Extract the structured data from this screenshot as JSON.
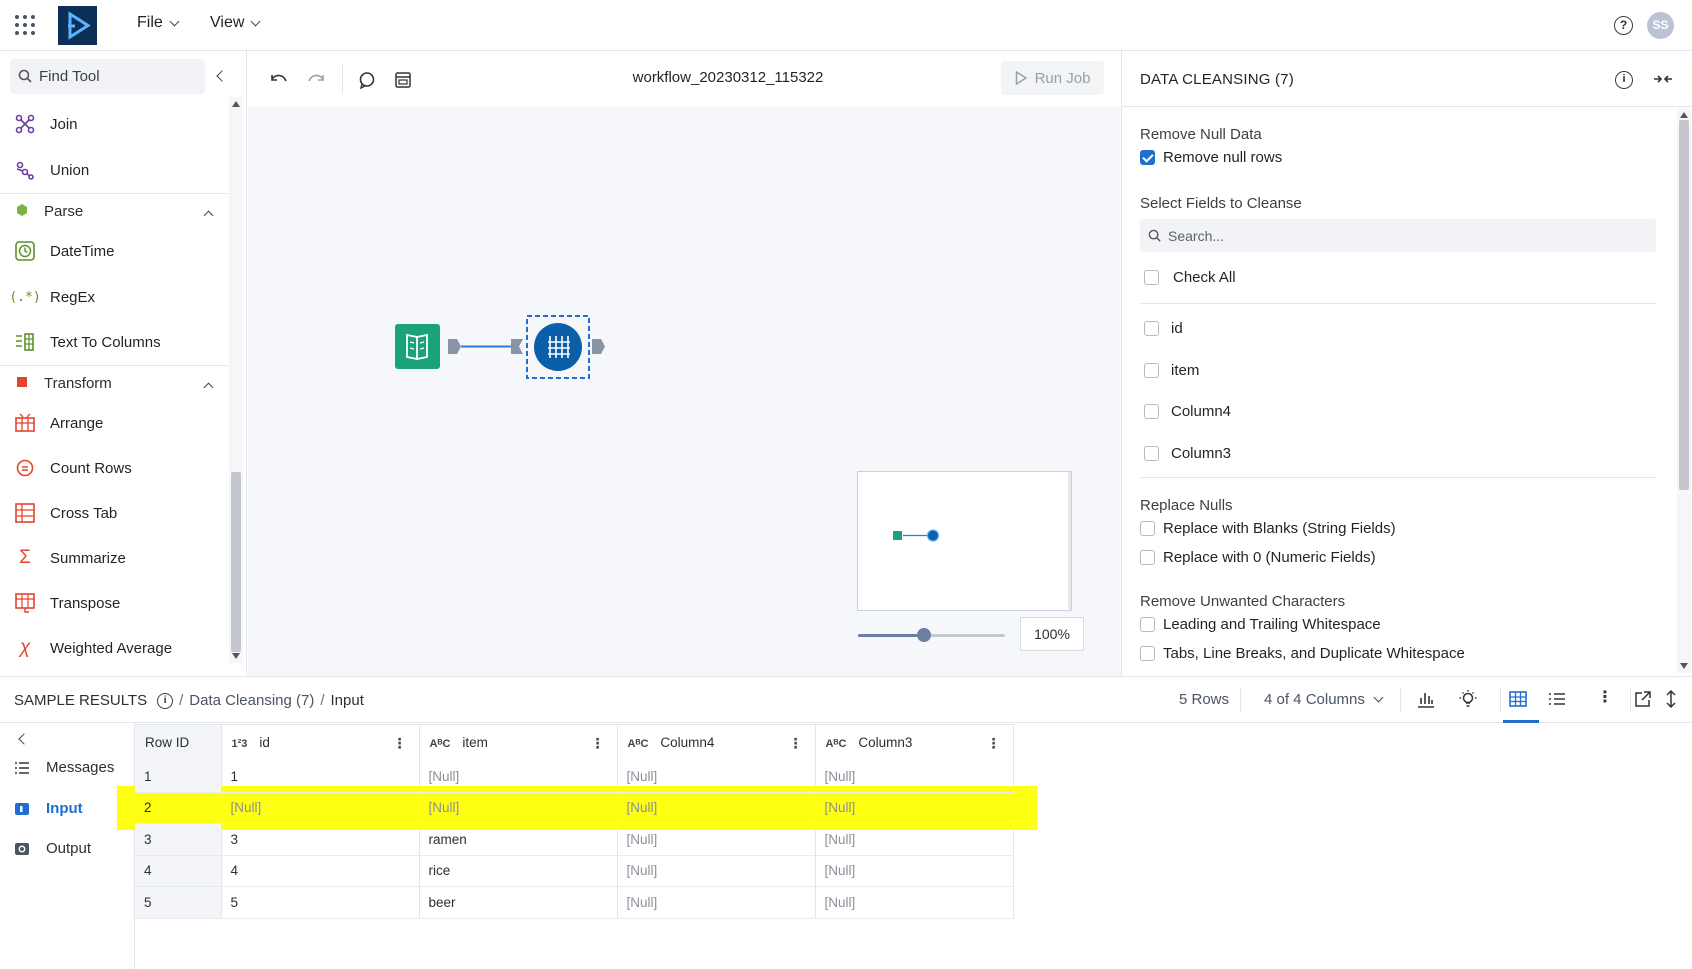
{
  "topbar": {
    "menu_file": "File",
    "menu_view": "View",
    "help": "?",
    "avatar_initials": "SS"
  },
  "left_panel": {
    "search_placeholder": "Find Tool",
    "tools_top": [
      {
        "name": "join",
        "label": "Join",
        "icon": "join-icon"
      },
      {
        "name": "union",
        "label": "Union",
        "icon": "union-icon"
      }
    ],
    "section_parse": "Parse",
    "tools_parse": [
      {
        "name": "datetime",
        "label": "DateTime",
        "icon": "clock-icon"
      },
      {
        "name": "regex",
        "label": "RegEx",
        "icon": "regex-icon"
      },
      {
        "name": "text-to-columns",
        "label": "Text To Columns",
        "icon": "columns-icon"
      }
    ],
    "section_transform": "Transform",
    "tools_transform": [
      {
        "name": "arrange",
        "label": "Arrange",
        "icon": "arrange-icon"
      },
      {
        "name": "count-rows",
        "label": "Count Rows",
        "icon": "count-icon"
      },
      {
        "name": "cross-tab",
        "label": "Cross Tab",
        "icon": "crosstab-icon"
      },
      {
        "name": "summarize",
        "label": "Summarize",
        "icon": "sigma-icon"
      },
      {
        "name": "transpose",
        "label": "Transpose",
        "icon": "transpose-icon"
      },
      {
        "name": "weighted-average",
        "label": "Weighted Average",
        "icon": "weighted-icon"
      }
    ]
  },
  "canvas": {
    "workflow_name": "workflow_20230312_115322",
    "run_job": "Run Job",
    "zoom": "100%",
    "zoom_fraction": 0.45
  },
  "right_panel": {
    "title": "DATA CLEANSING (7)",
    "remove_null_label": "Remove Null Data",
    "remove_null_rows": "Remove null rows",
    "select_fields_label": "Select Fields to Cleanse",
    "search_placeholder": "Search...",
    "check_all": "Check All",
    "fields": [
      "id",
      "item",
      "Column4",
      "Column3"
    ],
    "replace_nulls_label": "Replace Nulls",
    "replace_blanks": "Replace with Blanks (String Fields)",
    "replace_zero": "Replace with 0 (Numeric Fields)",
    "remove_chars_label": "Remove Unwanted Characters",
    "leading_trailing": "Leading and Trailing Whitespace",
    "tabs_linebreaks": "Tabs, Line Breaks, and Duplicate Whitespace"
  },
  "results": {
    "title": "SAMPLE RESULTS",
    "crumb_tool": "Data Cleansing (7)",
    "crumb_sep": "/",
    "crumb_current": "Input",
    "rows_count": "5 Rows",
    "columns_count": "4 of 4 Columns",
    "nav": {
      "messages": "Messages",
      "input": "Input",
      "output": "Output"
    },
    "headers": {
      "rowid": "Row ID",
      "id": "id",
      "item": "item",
      "col4": "Column4",
      "col3": "Column3"
    },
    "type_numeric": "1²3",
    "type_string": "AᴮC",
    "rows": [
      [
        "1",
        "1",
        "[Null]",
        "[Null]",
        "[Null]"
      ],
      [
        "2",
        "[Null]",
        "[Null]",
        "[Null]",
        "[Null]"
      ],
      [
        "3",
        "3",
        "ramen",
        "[Null]",
        "[Null]"
      ],
      [
        "4",
        "4",
        "rice",
        "[Null]",
        "[Null]"
      ],
      [
        "5",
        "5",
        "beer",
        "[Null]",
        "[Null]"
      ]
    ]
  },
  "colors": {
    "accent": "#1f6fd0",
    "highlight": "#ffff00",
    "input_node": "#1aa37a",
    "cleanse_node": "#0b5ea8"
  }
}
